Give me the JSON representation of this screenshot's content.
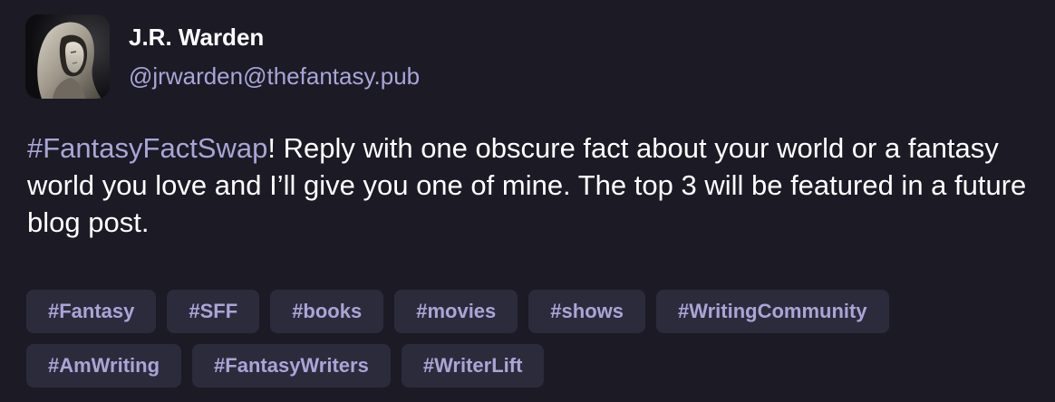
{
  "author": {
    "display_name": "J.R. Warden",
    "handle": "@jrwarden@thefantasy.pub"
  },
  "post": {
    "hashtag": "#FantasyFactSwap",
    "body": "! Reply with one obscure fact about your world or a fantasy world you love and I’ll give you one of mine. The top 3 will be featured in a future blog post."
  },
  "tags": {
    "row1": [
      "#Fantasy",
      "#SFF",
      "#books",
      "#movies",
      "#shows",
      "#WritingCommunity"
    ],
    "row2": [
      "#AmWriting",
      "#FantasyWriters",
      "#WriterLift"
    ]
  },
  "colors": {
    "background": "#1b1a25",
    "accent": "#a9a5d6",
    "tag_background": "#2c2b3c",
    "text": "#ffffff"
  }
}
